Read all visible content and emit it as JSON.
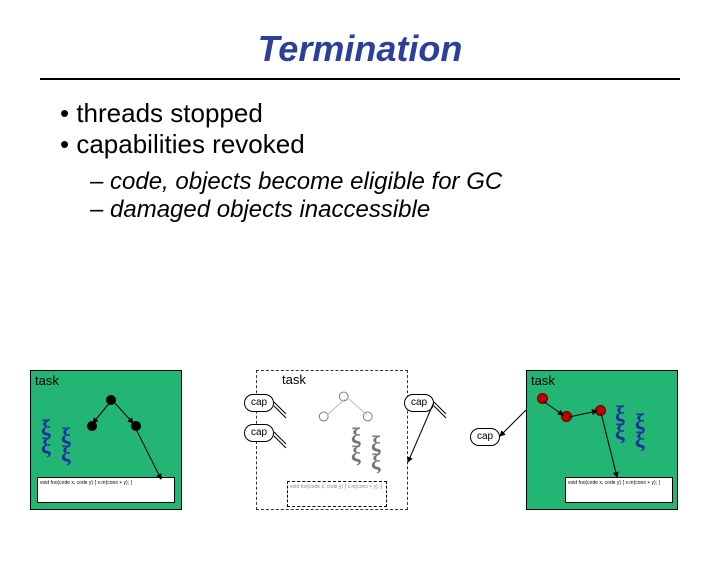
{
  "title": "Termination",
  "bullets": [
    "threads stopped",
    "capabilities revoked"
  ],
  "subbullets": [
    "code, objects become eligible for GC",
    "damaged objects inaccessible"
  ],
  "tasks": {
    "left_label": "task",
    "mid_label": "task",
    "right_label": "task"
  },
  "caps": {
    "c1": "cap",
    "c2": "cap",
    "c3": "cap",
    "c4": "cap"
  },
  "code_snippet": "void foo(code x, code y)\n{ x.m(cons + y); }"
}
